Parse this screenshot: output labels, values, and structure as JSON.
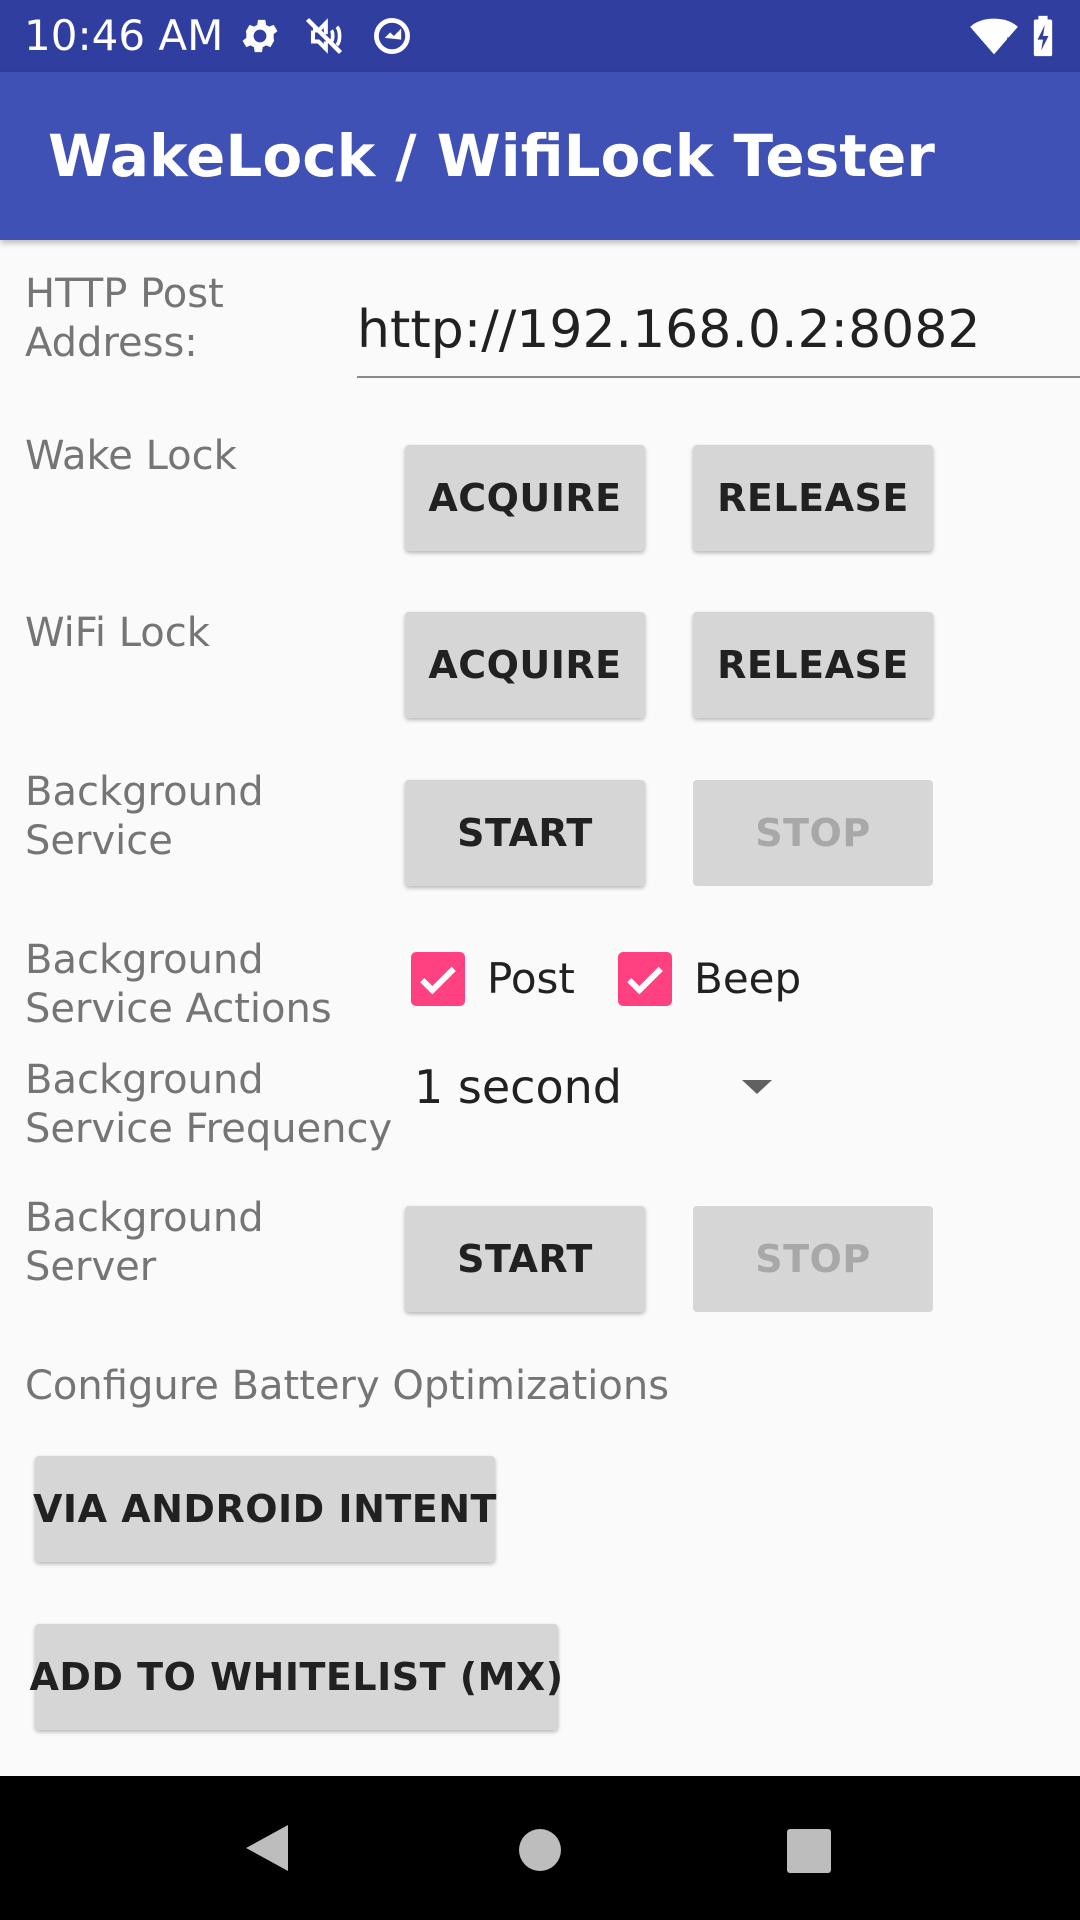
{
  "status_bar": {
    "time": "10:46 AM",
    "icons": [
      "gear-icon",
      "mute-icon",
      "sync-icon",
      "wifi-icon",
      "battery-charging-icon"
    ],
    "wifi_badge": "5"
  },
  "app_bar": {
    "title": "WakeLock / WifiLock Tester"
  },
  "form": {
    "http_post_label_line1": "HTTP Post",
    "http_post_label_line2": "Address:",
    "http_post_value": "http://192.168.0.2:8082",
    "wake_lock": {
      "label": "Wake Lock",
      "acquire": "ACQUIRE",
      "release": "RELEASE"
    },
    "wifi_lock": {
      "label": "WiFi Lock",
      "acquire": "ACQUIRE",
      "release": "RELEASE"
    },
    "bg_service": {
      "label_line1": "Background",
      "label_line2": "Service",
      "start": "START",
      "stop": "STOP"
    },
    "bg_actions": {
      "label_line1": "Background",
      "label_line2": "Service Actions",
      "post_label": "Post",
      "post_checked": true,
      "beep_label": "Beep",
      "beep_checked": true
    },
    "bg_frequency": {
      "label_line1": "Background",
      "label_line2": "Service Frequency",
      "value": "1 second"
    },
    "bg_server": {
      "label_line1": "Background",
      "label_line2": "Server",
      "start": "START",
      "stop": "STOP"
    },
    "battery": {
      "label": "Configure Battery Optimizations",
      "via_intent": "VIA ANDROID INTENT",
      "whitelist": "ADD TO WHITELIST (MX)"
    }
  },
  "colors": {
    "status_bar": "#303f9f",
    "app_bar": "#3f51b5",
    "checkbox_accent": "#ff4081",
    "background": "#fafafa"
  },
  "nav_bar": {
    "icons": [
      "back-icon",
      "home-icon",
      "recents-icon"
    ]
  }
}
